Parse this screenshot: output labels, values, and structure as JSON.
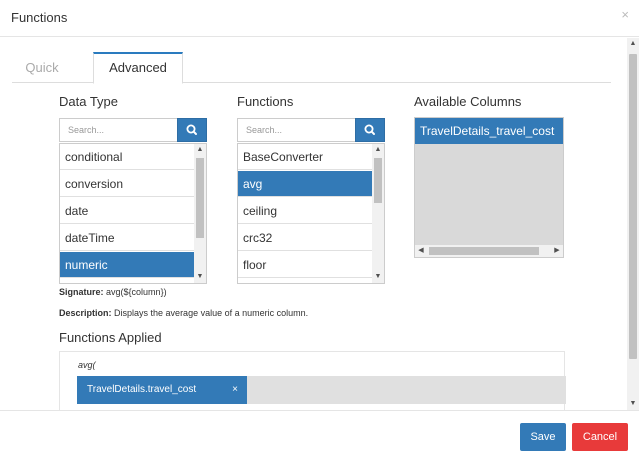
{
  "dialog": {
    "title": "Functions",
    "close_glyph": "×"
  },
  "tabs": [
    {
      "label": "Quick",
      "active": false
    },
    {
      "label": "Advanced",
      "active": true
    }
  ],
  "data_type": {
    "label": "Data Type",
    "search_placeholder": "Search...",
    "items": [
      {
        "label": "conditional",
        "selected": false
      },
      {
        "label": "conversion",
        "selected": false
      },
      {
        "label": "date",
        "selected": false
      },
      {
        "label": "dateTime",
        "selected": false
      },
      {
        "label": "numeric",
        "selected": true
      }
    ]
  },
  "functions": {
    "label": "Functions",
    "search_placeholder": "Search...",
    "items": [
      {
        "label": "BaseConverter",
        "selected": false
      },
      {
        "label": "avg",
        "selected": true
      },
      {
        "label": "ceiling",
        "selected": false
      },
      {
        "label": "crc32",
        "selected": false
      },
      {
        "label": "floor",
        "selected": false
      }
    ]
  },
  "available_columns": {
    "label": "Available Columns",
    "items": [
      {
        "label": "TravelDetails_travel_cost",
        "selected": true
      }
    ]
  },
  "signature": {
    "label": "Signature:",
    "value": "avg(${column})"
  },
  "description": {
    "label": "Description:",
    "value": "Displays the average value of a numeric column."
  },
  "functions_applied": {
    "label": "Functions Applied",
    "expression": "avg(",
    "chip_label": "TravelDetails.travel_cost",
    "chip_remove": "×"
  },
  "footer": {
    "save_label": "Save",
    "cancel_label": "Cancel"
  },
  "icons": {
    "search": "search-icon",
    "close": "close-icon"
  },
  "colors": {
    "primary": "#337ab7",
    "danger": "#e83a3a",
    "tab_accent": "#2a7bbf"
  }
}
